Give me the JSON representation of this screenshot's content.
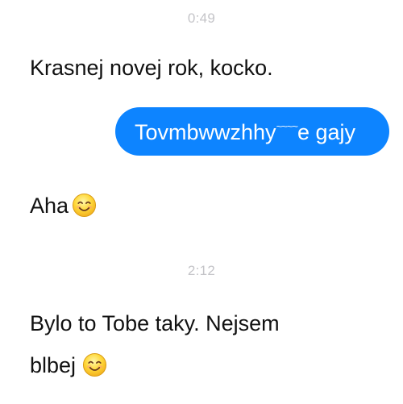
{
  "conversation": {
    "timestamps": [
      "0:49",
      "2:12"
    ],
    "messages": [
      {
        "direction": "incoming",
        "text": "Krasnej novej rok, kocko."
      },
      {
        "direction": "outgoing",
        "text_before": "Tovmbwwzhhy",
        "tilde": "̃̃̃̃̃",
        "text_after": "e gajy"
      },
      {
        "direction": "incoming",
        "text": "Aha",
        "emoji": "smiling-face-icon"
      },
      {
        "direction": "incoming",
        "line1": "Bylo to Tobe taky. Nejsem",
        "line2": "blbej",
        "emoji": "smiling-face-icon"
      }
    ]
  },
  "colors": {
    "outgoing_bubble": "#0d84ff",
    "timestamp": "#c4c4c8",
    "text": "#111111"
  }
}
